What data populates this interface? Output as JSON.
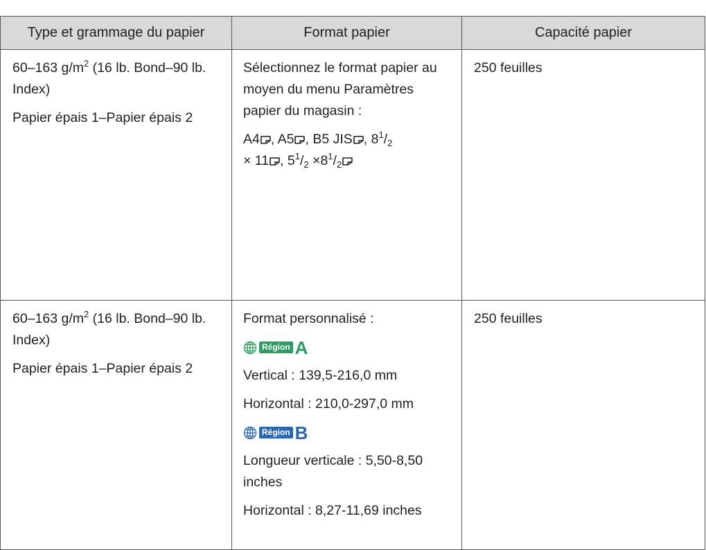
{
  "table": {
    "headers": [
      "Type et grammage du papier",
      "Format papier",
      "Capacité papier"
    ],
    "rows": [
      {
        "weight": {
          "prefix": "60–163 g/m",
          "exp": "2",
          "suffix": " (16 lb. Bond–90 lb. Index)"
        },
        "paper_type": "Papier épais 1–Papier épais 2",
        "format": {
          "instruction": "Sélectionnez le format papier au moyen du menu Paramètres papier du magasin :",
          "sizes": {
            "a4": "A4",
            "a5": ", A5",
            "b5": ", B5 JIS",
            "letter_a": ", 8",
            "letter_sup": "1",
            "letter_slash": "/",
            "letter_sub": "2",
            "letter_b": "× 11",
            "half_a": ", 5",
            "half_sup": "1",
            "half_slash": "/",
            "half_sub": "2",
            "half_b": " ×8",
            "half_sup2": "1",
            "half_slash2": "/",
            "half_sub2": "2"
          }
        },
        "capacity": "250 feuilles"
      },
      {
        "weight": {
          "prefix": "60–163 g/m",
          "exp": "2",
          "suffix": " (16 lb. Bond–90 lb. Index)"
        },
        "paper_type": "Papier épais 1–Papier épais 2",
        "format": {
          "custom_label": "Format personnalisé :",
          "region_a": {
            "label": "Région",
            "letter": "A"
          },
          "vertical_a": "Vertical : 139,5-216,0 mm",
          "horizontal_a": "Horizontal : 210,0-297,0 mm",
          "region_b": {
            "label": "Région",
            "letter": "B"
          },
          "vertical_b": "Longueur verticale : 5,50-8,50 inches",
          "horizontal_b": "Horizontal : 8,27-11,69 inches"
        },
        "capacity": "250 feuilles"
      }
    ]
  },
  "icons": {
    "orientation": "paper-orientation-icon",
    "region": "globe-icon"
  },
  "colors": {
    "header_bg": "#d9d9d9",
    "region_a": "#2e9c62",
    "region_b": "#2a66b2",
    "border": "#555555"
  }
}
